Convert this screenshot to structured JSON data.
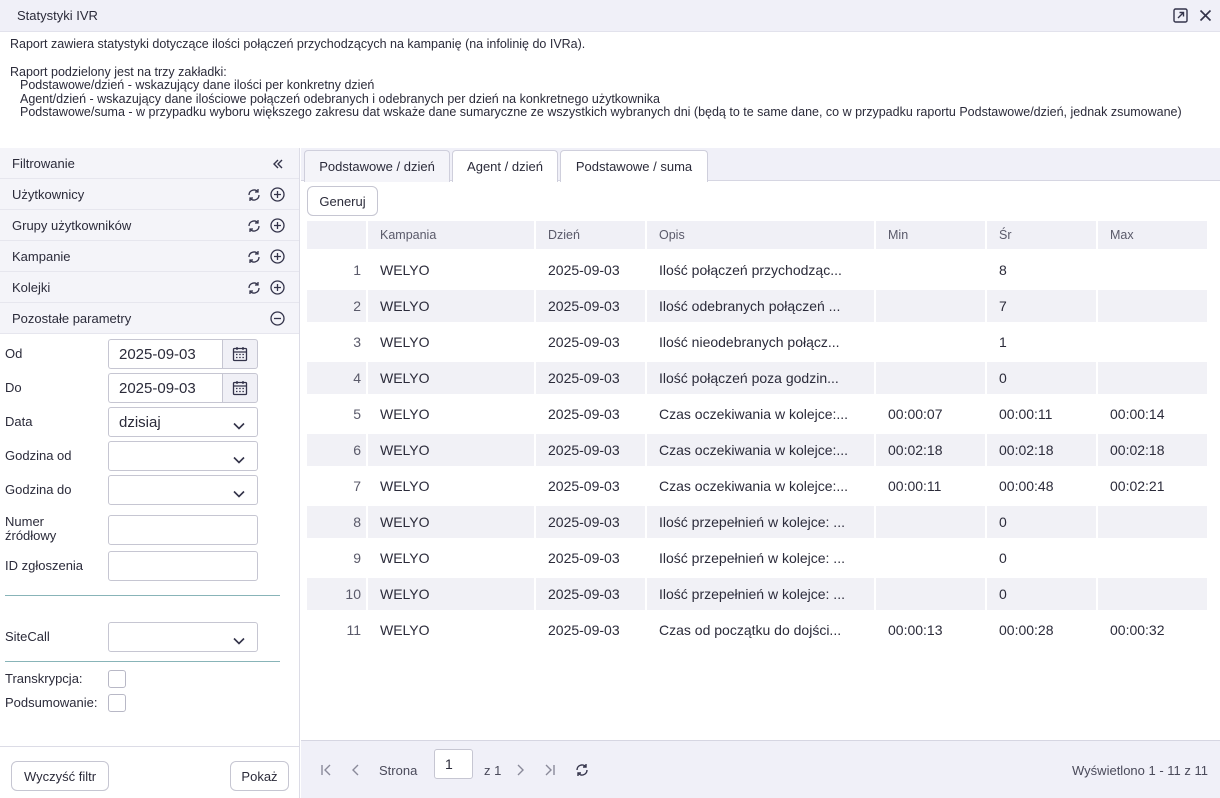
{
  "window": {
    "title": "Statystyki IVR",
    "icons": [
      "open-external-icon",
      "close-icon"
    ]
  },
  "description": {
    "line1": "Raport zawiera statystyki dotyczące ilości połączeń przychodzących na kampanię (na infolinię do IVRa).",
    "line2": "Raport podzielony jest na trzy zakładki:",
    "line3": "Podstawowe/dzień - wskazujący dane ilości per konkretny dzień",
    "line4": "Agent/dzień - wskazujący dane ilościowe połączeń odebranych i odebranych per dzień na konkretnego użytkownika",
    "line5": "Podstawowe/suma - w przypadku wyboru większego zakresu dat wskaże dane sumaryczne ze wszystkich wybranych dni (będą to te same dane, co w przypadku raportu Podstawowe/dzień, jednak zsumowane)"
  },
  "sidebar": {
    "header": "Filtrowanie",
    "sections": [
      "Użytkownicy",
      "Grupy użytkowników",
      "Kampanie",
      "Kolejki",
      "Pozostałe parametry"
    ],
    "labels": {
      "od": "Od",
      "do": "Do",
      "data": "Data",
      "godzina_od": "Godzina od",
      "godzina_do": "Godzina do",
      "numer_1": "Numer",
      "numer_2": "źródłowy",
      "id": "ID zgłoszenia",
      "sitecall": "SiteCall",
      "transkrypcja": "Transkrypcja:",
      "podsumowanie": "Podsumowanie:"
    },
    "values": {
      "od": "2025-09-03",
      "do": "2025-09-03",
      "data": "dzisiaj"
    },
    "buttons": {
      "clear": "Wyczyść filtr",
      "show": "Pokaż"
    }
  },
  "tabs": [
    "Podstawowe / dzień",
    "Agent / dzień",
    "Podstawowe / suma"
  ],
  "generate_label": "Generuj",
  "table": {
    "columns": [
      "",
      "Kampania",
      "Dzień",
      "Opis",
      "Min",
      "Śr",
      "Max"
    ],
    "rows": [
      [
        "1",
        "WELYO",
        "2025-09-03",
        "Ilość połączeń przychodząc...",
        "",
        "8",
        ""
      ],
      [
        "2",
        "WELYO",
        "2025-09-03",
        "Ilość odebranych połączeń ...",
        "",
        "7",
        ""
      ],
      [
        "3",
        "WELYO",
        "2025-09-03",
        "Ilość nieodebranych połącz...",
        "",
        "1",
        ""
      ],
      [
        "4",
        "WELYO",
        "2025-09-03",
        "Ilość połączeń poza godzin...",
        "",
        "0",
        ""
      ],
      [
        "5",
        "WELYO",
        "2025-09-03",
        "Czas oczekiwania w kolejce:...",
        "00:00:07",
        "00:00:11",
        "00:00:14"
      ],
      [
        "6",
        "WELYO",
        "2025-09-03",
        "Czas oczekiwania w kolejce:...",
        "00:02:18",
        "00:02:18",
        "00:02:18"
      ],
      [
        "7",
        "WELYO",
        "2025-09-03",
        "Czas oczekiwania w kolejce:...",
        "00:00:11",
        "00:00:48",
        "00:02:21"
      ],
      [
        "8",
        "WELYO",
        "2025-09-03",
        "Ilość przepełnień w kolejce: ...",
        "",
        "0",
        ""
      ],
      [
        "9",
        "WELYO",
        "2025-09-03",
        "Ilość przepełnień w kolejce: ...",
        "",
        "0",
        ""
      ],
      [
        "10",
        "WELYO",
        "2025-09-03",
        "Ilość przepełnień w kolejce: ...",
        "",
        "0",
        ""
      ],
      [
        "11",
        "WELYO",
        "2025-09-03",
        "Czas od początku do dojści...",
        "00:00:13",
        "00:00:28",
        "00:00:32"
      ]
    ]
  },
  "pager": {
    "page_label": "Strona",
    "page": "1",
    "of": "z 1",
    "summary": "Wyświetlono 1 - 11 z 11"
  },
  "colors": {
    "accent": "#5a5aa0",
    "divider": "#88b4b8"
  }
}
